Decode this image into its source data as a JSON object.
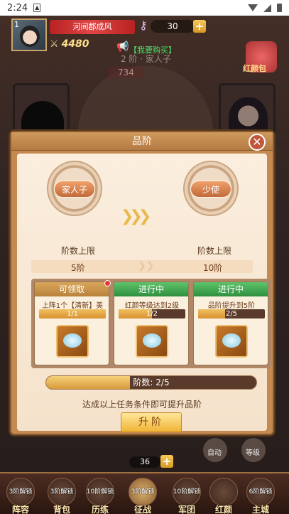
{
  "status_bar": {
    "time": "2:24",
    "notification_icon": "image-notification-icon"
  },
  "hud": {
    "player_level": "1",
    "player_name": "河间郡成风",
    "combat_power": "4480",
    "currency_amount": "30",
    "buy_link": "【我要购买】",
    "gift_label": "红颜包",
    "rank_background": "2 阶 · 家人子",
    "power_background": "734"
  },
  "modal": {
    "title": "品阶",
    "current_rank": "家人子",
    "next_rank": "少使",
    "cap_label_left": "阶数上限",
    "cap_label_right": "阶数上限",
    "cap_value_left": "5阶",
    "cap_value_right": "10阶",
    "tasks": [
      {
        "status": "可领取",
        "desc": "上阵1个【清新】美",
        "progress_text": "1/1",
        "progress": 1.0
      },
      {
        "status": "进行中",
        "desc": "红颜等级达到2级",
        "progress_text": "1/2",
        "progress": 0.5
      },
      {
        "status": "进行中",
        "desc": "品阶提升到5阶",
        "progress_text": "2/5",
        "progress": 0.4
      }
    ],
    "stage_text": "阶数: 2/5",
    "stage_progress": 0.4,
    "hint": "达成以上任务条件即可提升品阶",
    "upgrade_button": "升阶"
  },
  "bottom": {
    "auto_label": "自动",
    "level_label": "等级",
    "currency_amount": "36",
    "nav": [
      {
        "lock": "3阶解锁",
        "name": "阵容"
      },
      {
        "lock": "3阶解锁",
        "name": "背包"
      },
      {
        "lock": "10阶解锁",
        "name": "历练"
      },
      {
        "lock": "3阶解锁",
        "name": "征战"
      },
      {
        "lock": "10阶解锁",
        "name": "军团"
      },
      {
        "lock": "",
        "name": "红颜"
      },
      {
        "lock": "6阶解锁",
        "name": "主城"
      }
    ]
  },
  "colors": {
    "claimable": "#d9a65a",
    "in_progress": "#4aa85a",
    "accent": "#f0b436"
  }
}
